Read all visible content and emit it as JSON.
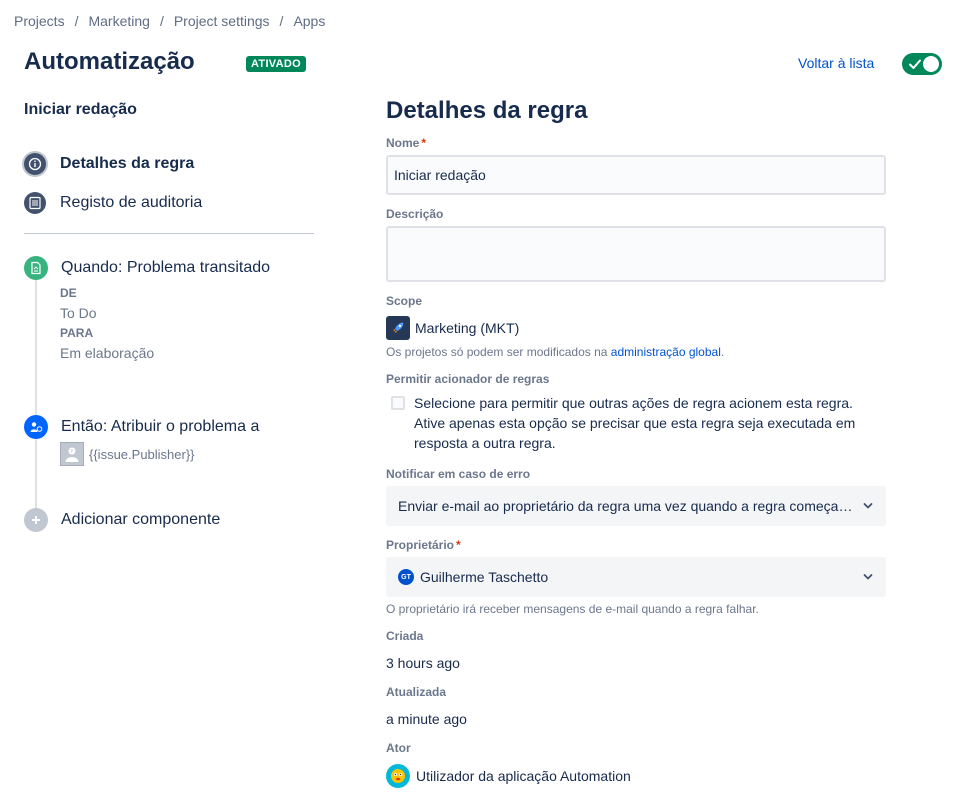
{
  "breadcrumb": [
    "Projects",
    "Marketing",
    "Project settings",
    "Apps"
  ],
  "breadcrumb_separator": "/",
  "header": {
    "title": "Automatização",
    "status_badge": "ATIVADO",
    "back_link": "Voltar à lista",
    "enabled": true
  },
  "sidebar": {
    "rule_name": "Iniciar redação",
    "nav": [
      {
        "label": "Detalhes da regra",
        "icon": "info-icon",
        "active": true
      },
      {
        "label": "Registo de auditoria",
        "icon": "list-icon",
        "active": false
      }
    ],
    "trigger": {
      "label": "Quando: Problema transitado",
      "from_label": "DE",
      "from_value": "To Do",
      "to_label": "PARA",
      "to_value": "Em elaboração"
    },
    "action": {
      "label": "Então: Atribuir o problema a",
      "assignee": "{{issue.Publisher}}"
    },
    "add_component": "Adicionar componente"
  },
  "details": {
    "title": "Detalhes da regra",
    "name_label": "Nome",
    "required_marker": "*",
    "name_value": "Iniciar redação",
    "description_label": "Descrição",
    "description_value": "",
    "scope_label": "Scope",
    "scope_value": "Marketing (MKT)",
    "scope_help_prefix": "Os projetos só podem ser modificados na",
    "scope_help_link": "administração global",
    "scope_help_suffix": ".",
    "allow_trigger_label": "Permitir acionador de regras",
    "allow_trigger_text": "Selecione para permitir que outras ações de regra acionem esta regra. Ative apenas esta opção se precisar que esta regra seja executada em resposta a outra regra.",
    "allow_trigger_checked": false,
    "notify_label": "Notificar em caso de erro",
    "notify_value": "Enviar e-mail ao proprietário da regra uma vez quando a regra começar a falhar",
    "owner_label": "Proprietário",
    "owner_initials": "GT",
    "owner_value": "Guilherme Taschetto",
    "owner_help": "O proprietário irá receber mensagens de e-mail quando a regra falhar.",
    "created_label": "Criada",
    "created_value": "3 hours ago",
    "updated_label": "Atualizada",
    "updated_value": "a minute ago",
    "actor_label": "Ator",
    "actor_value": "Utilizador da aplicação Automation"
  },
  "colors": {
    "success": "#00875a",
    "link": "#0052cc",
    "trigger_icon": "#36b37e",
    "action_icon": "#0065ff",
    "required": "#de350b"
  }
}
